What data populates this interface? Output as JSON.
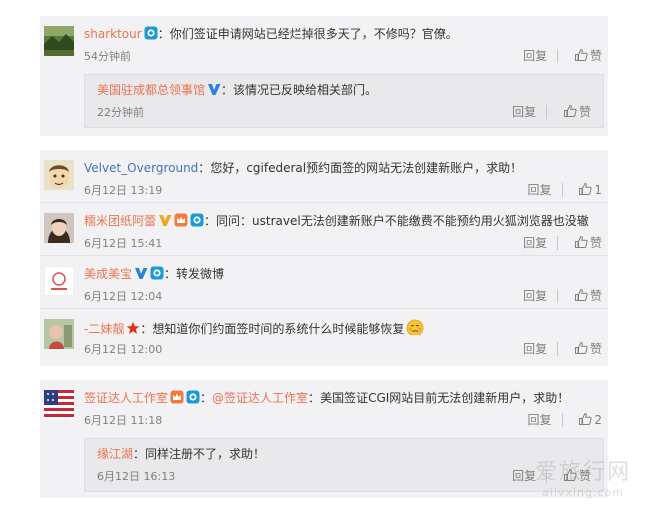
{
  "labels": {
    "reply": "回复",
    "like": "赞"
  },
  "colors": {
    "username": "#eb7350",
    "username_blue": "#4475b8",
    "verified_blue": "#2b82d9",
    "block_bg": "#f2f2f5",
    "sub_bg": "#e9e9ec"
  },
  "thread1": {
    "main": {
      "user": "sharktour",
      "sep": "：",
      "text": "你们签证申请网站已经烂掉很多天了，不修吗？官僚。",
      "time": "54分钟前",
      "avatar_icon": "landscape-avatar-icon",
      "badge_icon": "member-eye-icon"
    },
    "reply": {
      "user": "美国驻成都总领事馆",
      "sep": "：",
      "text": "该情况已反映给相关部门。",
      "time": "22分钟前",
      "badge_icon": "verified-v-icon"
    }
  },
  "thread2": {
    "comments": [
      {
        "user": "Velvet_Overground",
        "sep": "：",
        "text": "您好，cgifederal预约面签的网站无法创建新账户，求助！",
        "time": "6月12日 13:19",
        "like_count": "1",
        "avatar_icon": "cartoon-avatar-icon"
      },
      {
        "user": "糯米团纸阿蕾",
        "sep": "：",
        "text": "同问：ustravel无法创建新账户不能缴费不能预约用火狐浏览器也没辙",
        "time": "6月12日 15:41",
        "avatar_icon": "girl-avatar-icon"
      },
      {
        "user": "美成美宝",
        "sep": "：",
        "text": "转发微博",
        "time": "6月12日 12:04",
        "avatar_icon": "logo-avatar-icon"
      },
      {
        "user": "-二妹靓",
        "sep": "：",
        "text": "想知道你们约面签时间的系统什么时候能够恢复",
        "time": "6月12日 12:00",
        "avatar_icon": "photo-avatar-icon"
      }
    ]
  },
  "thread3": {
    "main": {
      "user": "签证达人工作室",
      "sep": "：",
      "at": "@签证达人工作室",
      "text": "美国签证CGI网站目前无法创建新用户，求助！",
      "time": "6月12日 11:18",
      "like_count": "2",
      "avatar_icon": "us-flag-avatar-icon"
    },
    "reply": {
      "user": "缘江湖",
      "sep": "：",
      "text": "同样注册不了，求助！",
      "time": "6月12日 16:13"
    }
  },
  "watermark": {
    "big": "爱旅行网",
    "small": "ailvxing.com"
  }
}
